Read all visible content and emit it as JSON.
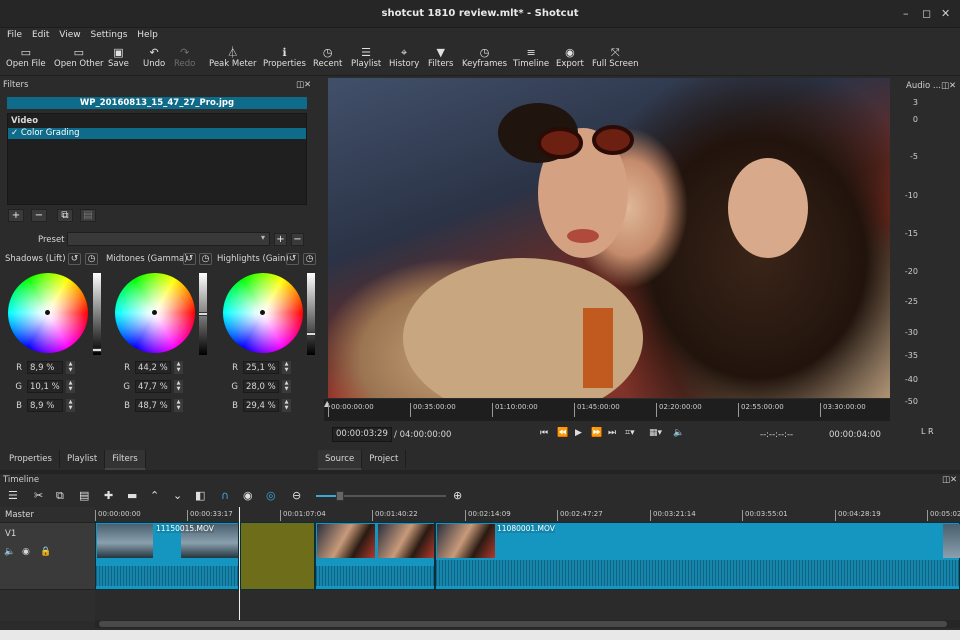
{
  "window": {
    "title": "shotcut 1810 review.mlt* - Shotcut",
    "minimize": "–",
    "restore": "◻",
    "close": "✕"
  },
  "menu": [
    "File",
    "Edit",
    "View",
    "Settings",
    "Help"
  ],
  "toolbar": [
    {
      "icon": "open-file-icon",
      "glyph": "▭",
      "label": "Open File"
    },
    {
      "icon": "open-other-icon",
      "glyph": "▭",
      "label": "Open Other"
    },
    {
      "icon": "save-icon",
      "glyph": "▣",
      "label": "Save"
    },
    {
      "icon": "undo-icon",
      "glyph": "↶",
      "label": "Undo"
    },
    {
      "icon": "redo-icon",
      "glyph": "↷",
      "label": "Redo"
    },
    {
      "icon": "peak-meter-icon",
      "glyph": "⏃",
      "label": "Peak Meter"
    },
    {
      "icon": "properties-icon",
      "glyph": "ℹ",
      "label": "Properties"
    },
    {
      "icon": "recent-icon",
      "glyph": "◷",
      "label": "Recent"
    },
    {
      "icon": "playlist-icon",
      "glyph": "☰",
      "label": "Playlist"
    },
    {
      "icon": "history-icon",
      "glyph": "⌖",
      "label": "History"
    },
    {
      "icon": "filters-icon",
      "glyph": "▼",
      "label": "Filters"
    },
    {
      "icon": "keyframes-icon",
      "glyph": "◷",
      "label": "Keyframes"
    },
    {
      "icon": "timeline-icon",
      "glyph": "≡",
      "label": "Timeline"
    },
    {
      "icon": "export-icon",
      "glyph": "◉",
      "label": "Export"
    },
    {
      "icon": "full-screen-icon",
      "glyph": "⤧",
      "label": "Full Screen"
    }
  ],
  "filters": {
    "header": "Filters",
    "file_name": "WP_20160813_15_47_27_Pro.jpg",
    "category": "Video",
    "selected_filter": "Color Grading",
    "preset_label": "Preset",
    "preset_arrow": "▾",
    "wheels": [
      {
        "label": "Shadows (Lift)",
        "R": "8,9 %",
        "G": "10,1 %",
        "B": "8,9 %",
        "level": 0.04
      },
      {
        "label": "Midtones (Gamma)",
        "R": "44,2 %",
        "G": "47,7 %",
        "B": "48,7 %",
        "level": 0.5
      },
      {
        "label": "Highlights (Gain)",
        "R": "25,1 %",
        "G": "28,0 %",
        "B": "29,4 %",
        "level": 0.25
      }
    ],
    "channel_names": [
      "R",
      "G",
      "B"
    ]
  },
  "left_tabs": [
    "Properties",
    "Playlist",
    "Filters"
  ],
  "player": {
    "ruler_ticks": [
      "00:00:00:00",
      "00:35:00:00",
      "01:10:00:00",
      "01:45:00:00",
      "02:20:00:00",
      "02:55:00:00",
      "03:30:00:00"
    ],
    "current_time": "00:00:03:29",
    "total_time": "/ 04:00:00:00",
    "in_point": "--:--:--:--",
    "duration": "00:00:04:00",
    "tabs": [
      "Source",
      "Project"
    ]
  },
  "audio": {
    "header": "Audio ...",
    "scale": [
      "3",
      "0",
      "-5",
      "-10",
      "-15",
      "-20",
      "-25",
      "-30",
      "-35",
      "-40",
      "-50"
    ],
    "channels": "L  R"
  },
  "timeline": {
    "header": "Timeline",
    "track_master": "Master",
    "track_v1": "V1",
    "ruler": [
      "00:00:00:00",
      "00:00:33:17",
      "00:01:07:04",
      "00:01:40:22",
      "00:02:14:09",
      "00:02:47:27",
      "00:03:21:14",
      "00:03:55:01",
      "00:04:28:19",
      "00:05:02:"
    ],
    "clips": [
      {
        "name": "11150015.MOV",
        "color": "blue"
      },
      {
        "name": "",
        "color": "olive"
      },
      {
        "name": "11080001.MOV",
        "color": "blue"
      }
    ]
  },
  "colors": {
    "accent": "#0e6c8a",
    "clip_blue": "#1596c0",
    "clip_olive": "#6d6d1a"
  }
}
